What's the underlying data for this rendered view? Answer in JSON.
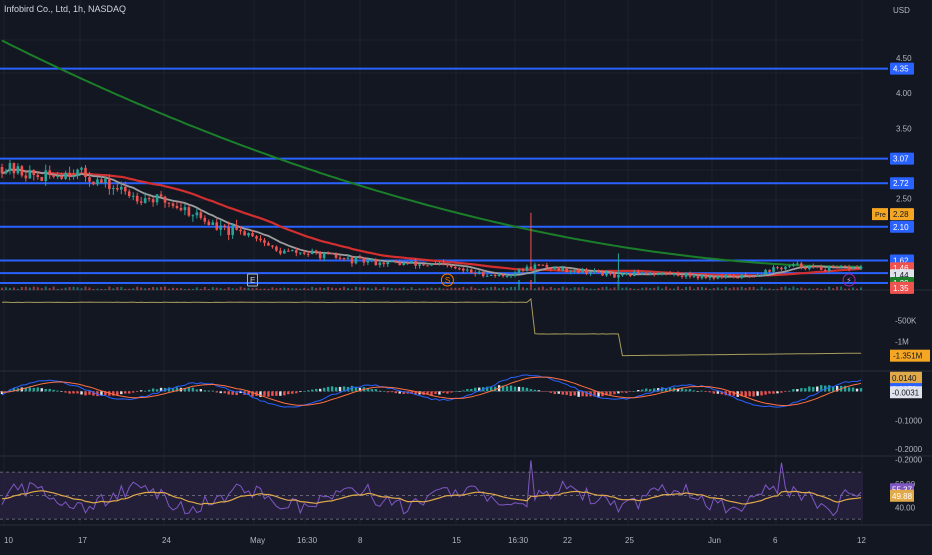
{
  "header": {
    "title": "Infobird Co., Ltd, 1h, NASDAQ",
    "currency": "USD"
  },
  "colors": {
    "background": "#131722",
    "grid": "#1e222d",
    "text": "#b2b5be",
    "up": "#26a69a",
    "down": "#ef5350",
    "hline": "#2962ff",
    "ma_long": "#1b7f2a",
    "ma_mid": "#d32f2f",
    "ma_short": "#9e9e9e",
    "volume_line": "#a89c5c",
    "macd": "#2962ff",
    "signal": "#ff7043",
    "rsi": "#7e57c2",
    "rsi_ma": "#e0a94a",
    "rsi_band": "#2a2342"
  },
  "chart_data": [
    {
      "type": "candlestick",
      "panel": "price",
      "x_ticks": [
        "10",
        "17",
        "24",
        "May",
        "16:30",
        "8",
        "15",
        "16:30",
        "22",
        "25",
        "Jun",
        "6",
        "12"
      ],
      "y_ticks": [
        "4.50",
        "4.00",
        "3.50",
        "2.50",
        "2.10"
      ],
      "ylim": [
        1.2,
        4.9
      ],
      "horizontal_levels": [
        4.35,
        3.07,
        2.72,
        2.1,
        1.62,
        1.44,
        1.3
      ],
      "price_labels": [
        {
          "text": "4.35",
          "value": 4.35,
          "color": "#2962ff"
        },
        {
          "text": "3.07",
          "value": 3.07,
          "color": "#2962ff"
        },
        {
          "text": "2.72",
          "value": 2.72,
          "color": "#2962ff"
        },
        {
          "text": "2.28",
          "value": 2.28,
          "color": "#f5a623",
          "prefix": "Pre"
        },
        {
          "text": "2.10",
          "value": 2.1,
          "color": "#2962ff"
        },
        {
          "text": "1.62",
          "value": 1.62,
          "color": "#2962ff"
        },
        {
          "text": "1.46",
          "value": 1.51,
          "color": "#ef5350"
        },
        {
          "text": "1.44",
          "value": 1.41,
          "color": "#e0e3eb"
        },
        {
          "text": "1.39",
          "value": 1.3,
          "color": "#1b7f2a"
        },
        {
          "text": "1.35",
          "value": 1.23,
          "color": "#ef5350"
        }
      ],
      "events": [
        {
          "label": "E",
          "x_index": 63
        },
        {
          "label": "S",
          "x_index": 112
        },
        {
          "label": "⚡",
          "x_index": 213
        }
      ]
    },
    {
      "type": "line",
      "panel": "volume",
      "y_ticks": [
        "-500K",
        "-1M"
      ],
      "ylim": [
        -1.7,
        0.2
      ],
      "value_label": "-1.351M",
      "value_label_value": -1.351
    },
    {
      "type": "bar",
      "panel": "macd",
      "y_ticks": [
        "-0.1000",
        "-0.2000"
      ],
      "ylim": [
        -0.22,
        0.06
      ],
      "value_labels": [
        {
          "text": "0.0140",
          "value": 0.047,
          "color": "#e0a94a"
        },
        {
          "text": "0.0079",
          "value": 0.0079,
          "color": "#2962ff"
        },
        {
          "text": "-0.0031",
          "value": -0.0031,
          "color": "#e0e3eb"
        }
      ]
    },
    {
      "type": "line",
      "panel": "rsi",
      "y_ticks": [
        "-0.2000",
        "60.00",
        "40.00"
      ],
      "ylim": [
        25,
        82
      ],
      "band": [
        30,
        70
      ],
      "value_labels": [
        {
          "text": "55.37",
          "value": 55.37,
          "color": "#7e57c2"
        },
        {
          "text": "49.88",
          "value": 49.88,
          "color": "#e0a94a"
        }
      ]
    }
  ]
}
